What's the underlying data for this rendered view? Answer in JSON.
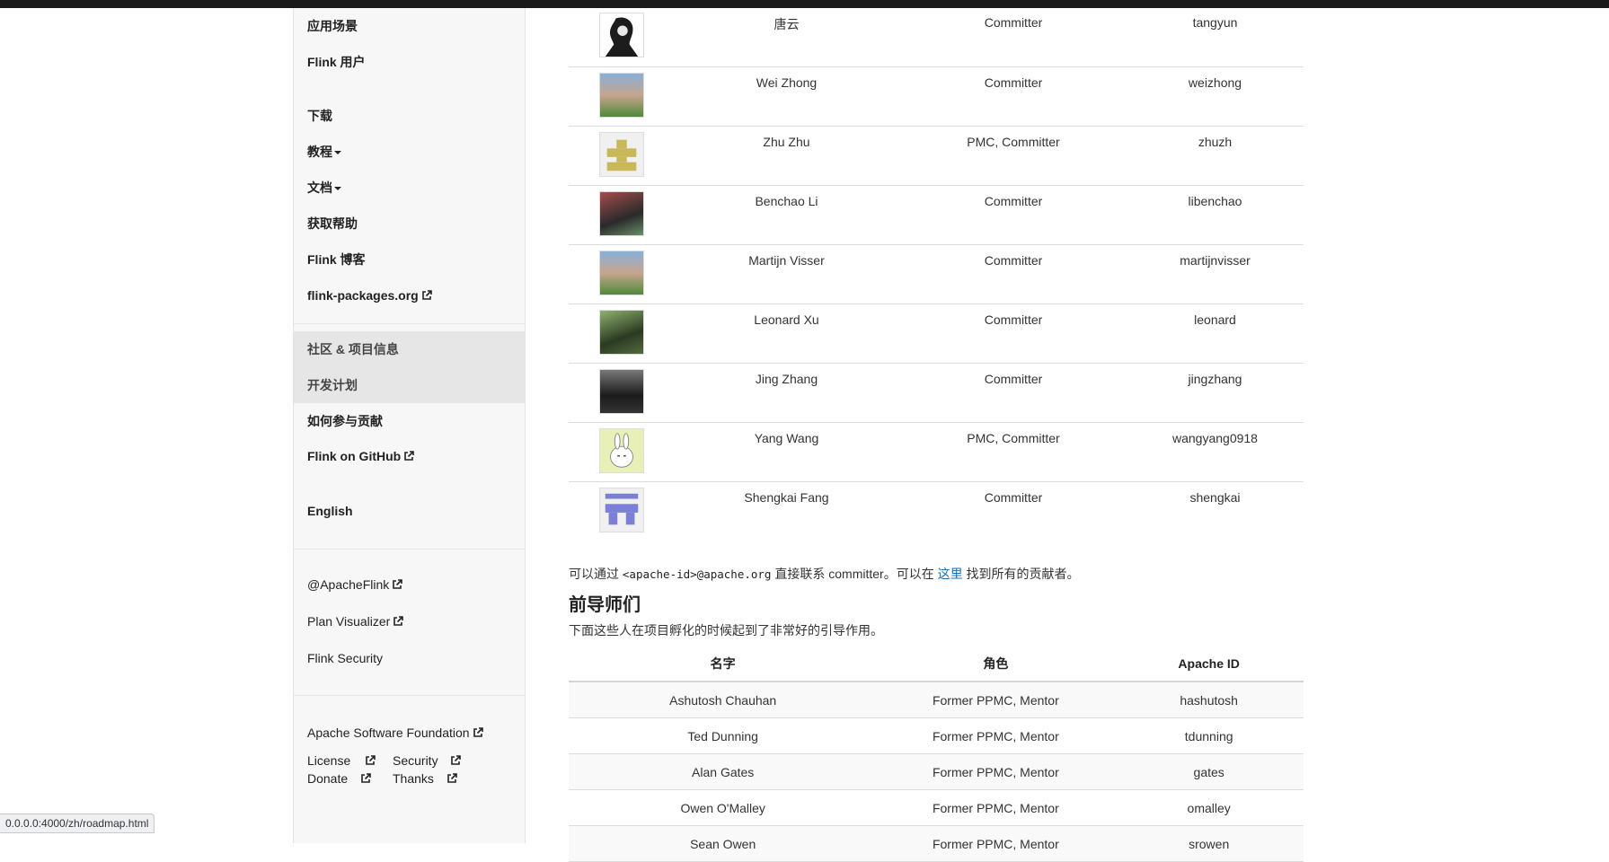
{
  "nav": {
    "items": [
      {
        "label": "应用场景",
        "caret": false,
        "ext": false
      },
      {
        "label": "Flink 用户",
        "caret": false,
        "ext": false
      },
      {
        "label": "下载",
        "caret": false,
        "ext": false
      },
      {
        "label": "教程",
        "caret": true,
        "ext": false
      },
      {
        "label": "文档",
        "caret": true,
        "ext": false
      },
      {
        "label": "获取帮助",
        "caret": false,
        "ext": false
      },
      {
        "label": "Flink 博客",
        "caret": false,
        "ext": false
      },
      {
        "label": "flink-packages.org",
        "caret": false,
        "ext": true
      },
      {
        "label": "社区 & 项目信息",
        "caret": false,
        "ext": false,
        "active": true
      },
      {
        "label": "开发计划",
        "caret": false,
        "ext": false,
        "active": true
      },
      {
        "label": "如何参与贡献",
        "caret": false,
        "ext": false
      },
      {
        "label": "Flink on GitHub",
        "caret": false,
        "ext": true
      },
      {
        "label": "English",
        "caret": false,
        "ext": false
      }
    ],
    "secondary": [
      {
        "label": "@ApacheFlink",
        "ext": true
      },
      {
        "label": "Plan Visualizer",
        "ext": true
      },
      {
        "label": "Flink Security",
        "ext": false
      }
    ],
    "footer": {
      "asf": "Apache Software Foundation",
      "license": "License",
      "security": "Security",
      "donate": "Donate",
      "thanks": "Thanks"
    }
  },
  "committers": [
    {
      "name": "唐云",
      "role": "Committer",
      "apache_id": "tangyun"
    },
    {
      "name": "Wei Zhong",
      "role": "Committer",
      "apache_id": "weizhong"
    },
    {
      "name": "Zhu Zhu",
      "role": "PMC, Committer",
      "apache_id": "zhuzh"
    },
    {
      "name": "Benchao Li",
      "role": "Committer",
      "apache_id": "libenchao"
    },
    {
      "name": "Martijn Visser",
      "role": "Committer",
      "apache_id": "martijnvisser"
    },
    {
      "name": "Leonard Xu",
      "role": "Committer",
      "apache_id": "leonard"
    },
    {
      "name": "Jing Zhang",
      "role": "Committer",
      "apache_id": "jingzhang"
    },
    {
      "name": "Yang Wang",
      "role": "PMC, Committer",
      "apache_id": "wangyang0918"
    },
    {
      "name": "Shengkai Fang",
      "role": "Committer",
      "apache_id": "shengkai"
    }
  ],
  "contact_note": {
    "prefix": "可以通过",
    "code": "<apache-id>@apache.org",
    "middle": "直接联系 committer。可以在",
    "link": "这里",
    "suffix": "找到所有的贡献者。"
  },
  "mentors_section": {
    "title": "前导师们",
    "description": "下面这些人在项目孵化的时候起到了非常好的引导作用。",
    "headers": {
      "name": "名字",
      "role": "角色",
      "apache_id": "Apache ID"
    },
    "rows": [
      {
        "name": "Ashutosh Chauhan",
        "role": "Former PPMC, Mentor",
        "apache_id": "hashutosh"
      },
      {
        "name": "Ted Dunning",
        "role": "Former PPMC, Mentor",
        "apache_id": "tdunning"
      },
      {
        "name": "Alan Gates",
        "role": "Former PPMC, Mentor",
        "apache_id": "gates"
      },
      {
        "name": "Owen O'Malley",
        "role": "Former PPMC, Mentor",
        "apache_id": "omalley"
      },
      {
        "name": "Sean Owen",
        "role": "Former PPMC, Mentor",
        "apache_id": "srowen"
      }
    ]
  },
  "status_url": "0.0.0.0:4000/zh/roadmap.html"
}
